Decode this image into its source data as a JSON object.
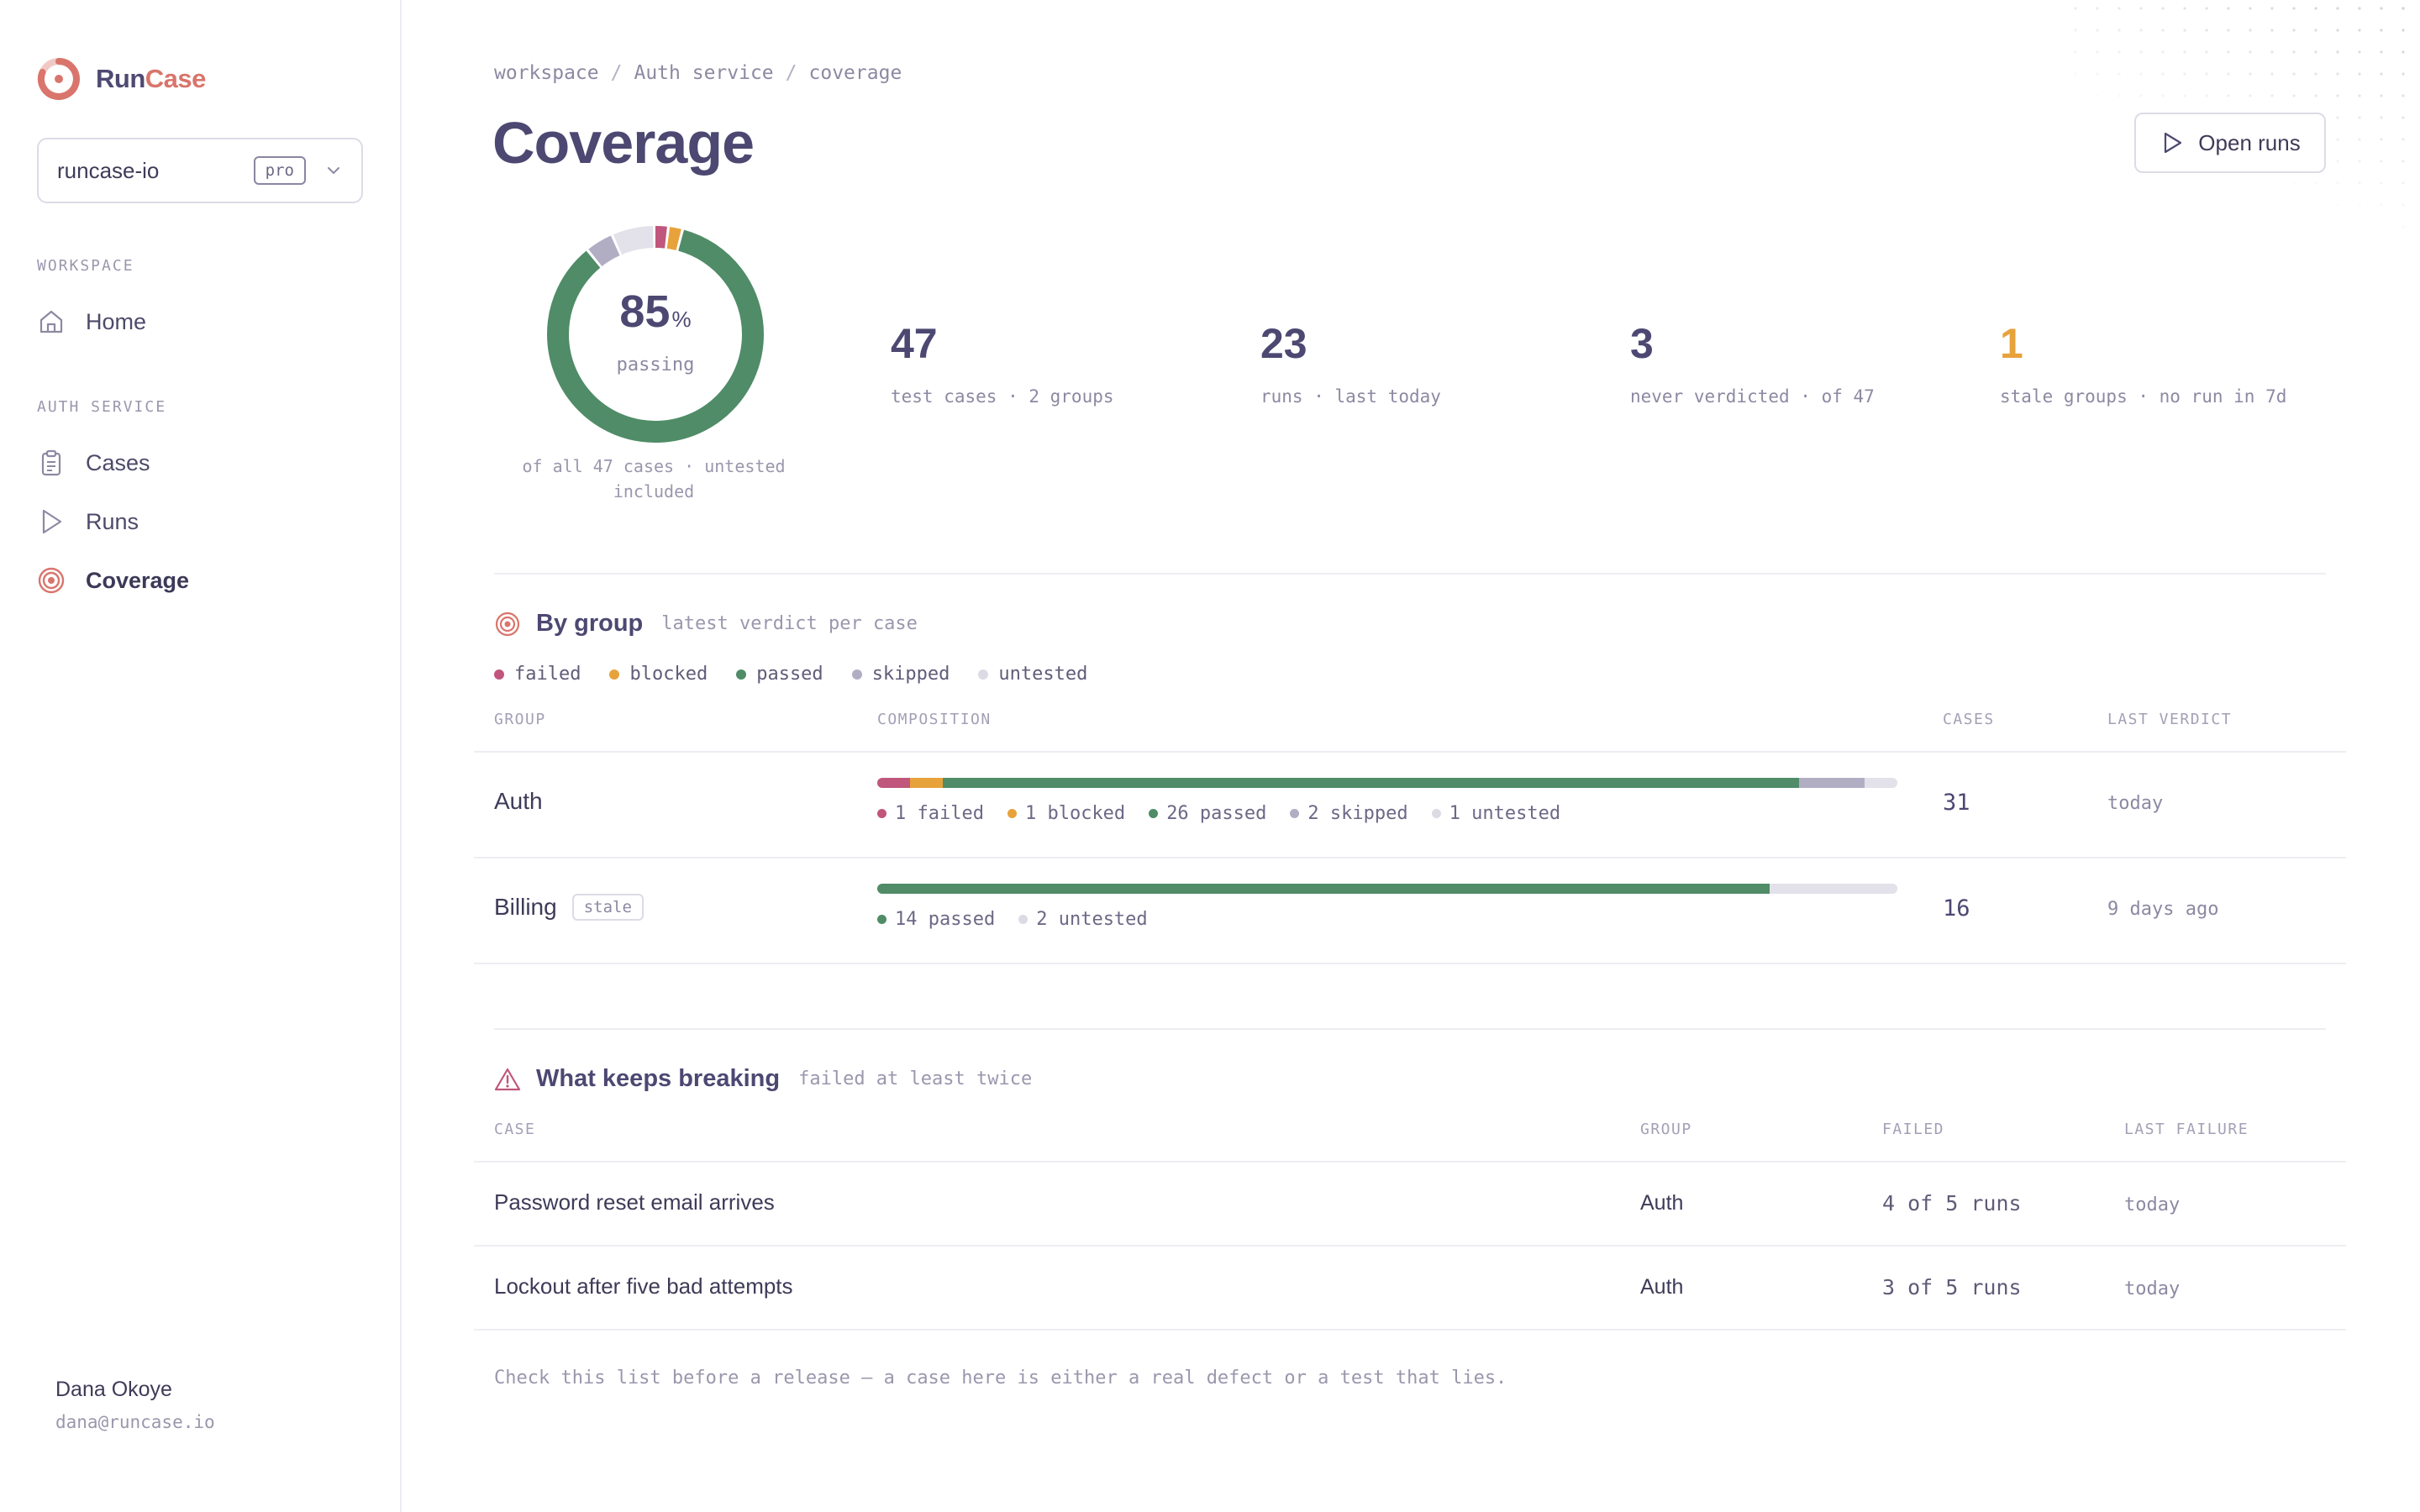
{
  "brand": {
    "name_part1": "Run",
    "name_part2": "Case"
  },
  "workspace_select": {
    "value": "runcase-io",
    "badge": "pro"
  },
  "sidebar": {
    "sections": [
      {
        "label": "WORKSPACE",
        "items": [
          {
            "label": "Home",
            "icon": "home-icon"
          }
        ]
      },
      {
        "label": "AUTH SERVICE",
        "items": [
          {
            "label": "Cases",
            "icon": "clipboard-icon"
          },
          {
            "label": "Runs",
            "icon": "play-icon"
          },
          {
            "label": "Coverage",
            "icon": "target-icon",
            "active": true
          }
        ]
      }
    ]
  },
  "user": {
    "name": "Dana Okoye",
    "email": "dana@runcase.io"
  },
  "breadcrumb": [
    "workspace",
    "Auth service",
    "coverage"
  ],
  "page_title": "Coverage",
  "open_runs_label": "Open runs",
  "donut": {
    "value": "85",
    "unit": "%",
    "label": "passing",
    "caption": "of all 47 cases · untested included",
    "segments": [
      {
        "status": "failed",
        "count": 1
      },
      {
        "status": "blocked",
        "count": 1
      },
      {
        "status": "passed",
        "count": 40
      },
      {
        "status": "skipped",
        "count": 2
      },
      {
        "status": "untested",
        "count": 3
      }
    ]
  },
  "stats": [
    {
      "value": "47",
      "label": "test cases · 2 groups"
    },
    {
      "value": "23",
      "label": "runs · last today"
    },
    {
      "value": "3",
      "label": "never verdicted · of 47"
    },
    {
      "value": "1",
      "label": "stale groups · no run in 7d",
      "warn": true
    }
  ],
  "colors": {
    "failed": "#c0567b",
    "blocked": "#e8a23b",
    "passed": "#4f8c67",
    "skipped": "#b1aec4",
    "untested": "#e3e1e9",
    "accent": "#d9756c"
  },
  "by_group": {
    "title": "By group",
    "subtitle": "latest verdict per case",
    "legend": [
      "failed",
      "blocked",
      "passed",
      "skipped",
      "untested"
    ],
    "columns": {
      "group": "GROUP",
      "composition": "COMPOSITION",
      "cases": "CASES",
      "last_verdict": "LAST VERDICT"
    },
    "rows": [
      {
        "name": "Auth",
        "badge": "",
        "cases": "31",
        "last_verdict": "today",
        "composition": [
          {
            "status": "failed",
            "count": 1,
            "label": "1 failed"
          },
          {
            "status": "blocked",
            "count": 1,
            "label": "1 blocked"
          },
          {
            "status": "passed",
            "count": 26,
            "label": "26 passed"
          },
          {
            "status": "skipped",
            "count": 2,
            "label": "2 skipped"
          },
          {
            "status": "untested",
            "count": 1,
            "label": "1 untested"
          }
        ]
      },
      {
        "name": "Billing",
        "badge": "stale",
        "cases": "16",
        "last_verdict": "9 days ago",
        "composition": [
          {
            "status": "passed",
            "count": 14,
            "label": "14 passed"
          },
          {
            "status": "untested",
            "count": 2,
            "label": "2 untested"
          }
        ]
      }
    ]
  },
  "breaking": {
    "title": "What keeps breaking",
    "subtitle": "failed at least twice",
    "columns": {
      "case": "CASE",
      "group": "GROUP",
      "failed": "FAILED",
      "last_failure": "LAST FAILURE"
    },
    "rows": [
      {
        "case": "Password reset email arrives",
        "group": "Auth",
        "failed": "4 of 5 runs",
        "last_failure": "today"
      },
      {
        "case": "Lockout after five bad attempts",
        "group": "Auth",
        "failed": "3 of 5 runs",
        "last_failure": "today"
      }
    ],
    "footnote": "Check this list before a release — a case here is either a real defect or a test that lies."
  }
}
